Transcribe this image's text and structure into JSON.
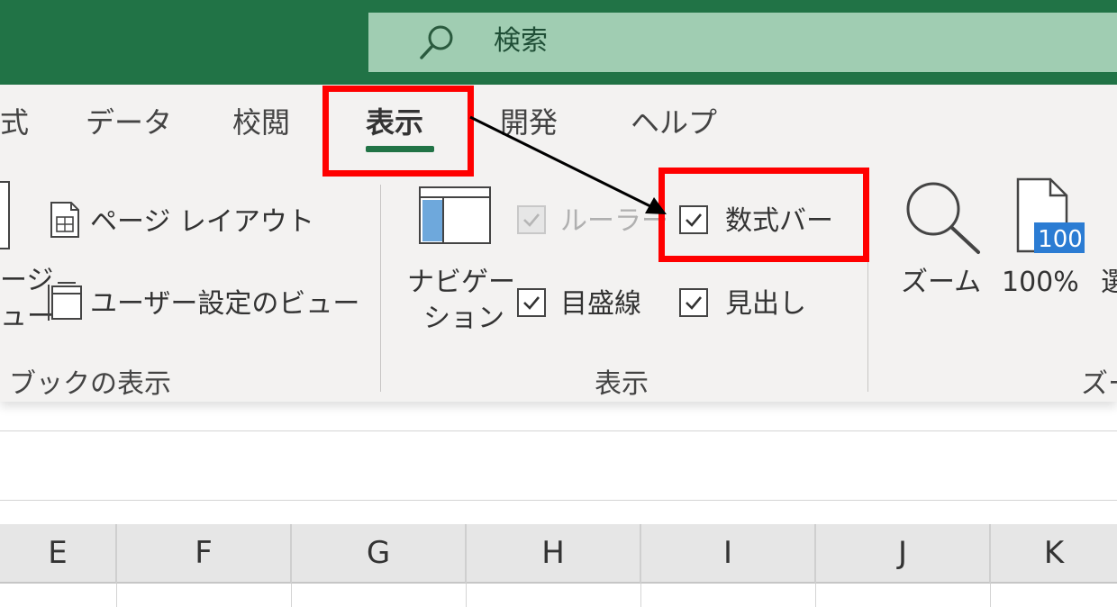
{
  "search": {
    "label": "検索",
    "icon": "search-icon"
  },
  "tabs": [
    {
      "label": "式"
    },
    {
      "label": "データ"
    },
    {
      "label": "校閲"
    },
    {
      "label": "表示",
      "active": true
    },
    {
      "label": "開発"
    },
    {
      "label": "ヘルプ"
    }
  ],
  "book_view_group": {
    "label": "ブックの表示",
    "items": {
      "page_layout": "ページ レイアウト",
      "custom_view": "ユーザー設定のビュー",
      "partial_top": "ージ",
      "partial_bottom": "ュー"
    }
  },
  "show_group": {
    "label": "表示",
    "navigation_line1": "ナビゲー",
    "navigation_line2": "ション",
    "ruler": {
      "label": "ルーラー",
      "checked": true,
      "disabled": true
    },
    "formula_bar": {
      "label": "数式バー",
      "checked": true
    },
    "gridlines": {
      "label": "目盛線",
      "checked": true
    },
    "headings": {
      "label": "見出し",
      "checked": true
    }
  },
  "zoom_group": {
    "label": "ズー",
    "zoom": "ズーム",
    "zoom100": "100%",
    "zoom100_badge": "100",
    "selection_partial": "選"
  },
  "columns": [
    "E",
    "F",
    "G",
    "H",
    "I",
    "J",
    "K"
  ],
  "colors": {
    "title_bar": "#217346",
    "search_bg": "#a0cdb2",
    "highlight": "#ff0000"
  }
}
